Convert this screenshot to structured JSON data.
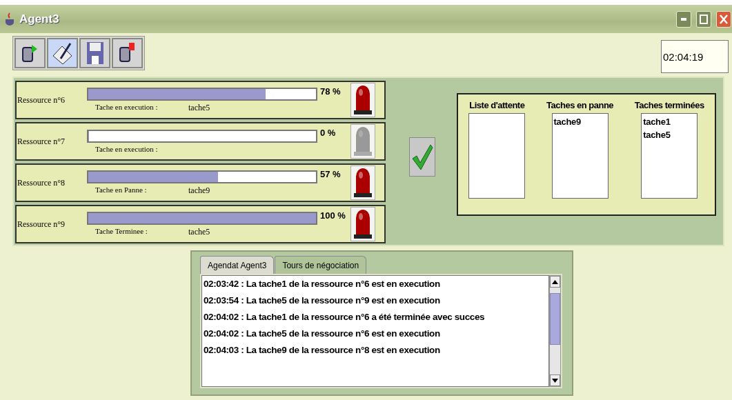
{
  "window": {
    "title": "Agent3"
  },
  "toolbar": [
    {
      "selected": false
    },
    {
      "selected": true
    },
    {
      "selected": false
    },
    {
      "selected": false
    }
  ],
  "clock": "02:04:19",
  "resources": [
    {
      "name": "Ressource n°6",
      "task_label": "Tache en execution :",
      "task": "tache5",
      "level": 0.78,
      "percent": "78 %",
      "lamp_on": true
    },
    {
      "name": "Ressource n°7",
      "task_label": "Tache en execution :",
      "level": 0,
      "percent": "0 %",
      "lamp_on": false
    },
    {
      "name": "Ressource n°8",
      "task_label": "Tache en Panne :",
      "task": "tache9",
      "level": 0.57,
      "percent": "57 %",
      "lamp_on": true
    },
    {
      "name": "Ressource n°9",
      "task_label": "Tache Terminee :",
      "task": "tache5",
      "level": 1,
      "percent": "100 %",
      "lamp_on": true
    }
  ],
  "lists": [
    {
      "title": "Liste d'attente"
    },
    {
      "title": "Taches en panne",
      "items": [
        "tache9"
      ]
    },
    {
      "title": "Taches terminées",
      "items": [
        "tache1",
        "tache5"
      ]
    }
  ],
  "tabs": [
    {
      "label": "Agendat Agent3",
      "selected": true
    },
    {
      "label": "Tours de négociation",
      "selected": false
    }
  ],
  "log": [
    "02:03:42 : La tache1 de la ressource n°6 est en execution",
    "02:03:54 : La tache5 de la ressource n°9 est en execution",
    "02:04:02 : La tache1 de la ressource n°6 a été terminée avec succes",
    "02:04:02 : La tache5 de la ressource n°6 est en execution",
    "02:04:03 : La tache9 de la ressource n°8 est en execution"
  ]
}
